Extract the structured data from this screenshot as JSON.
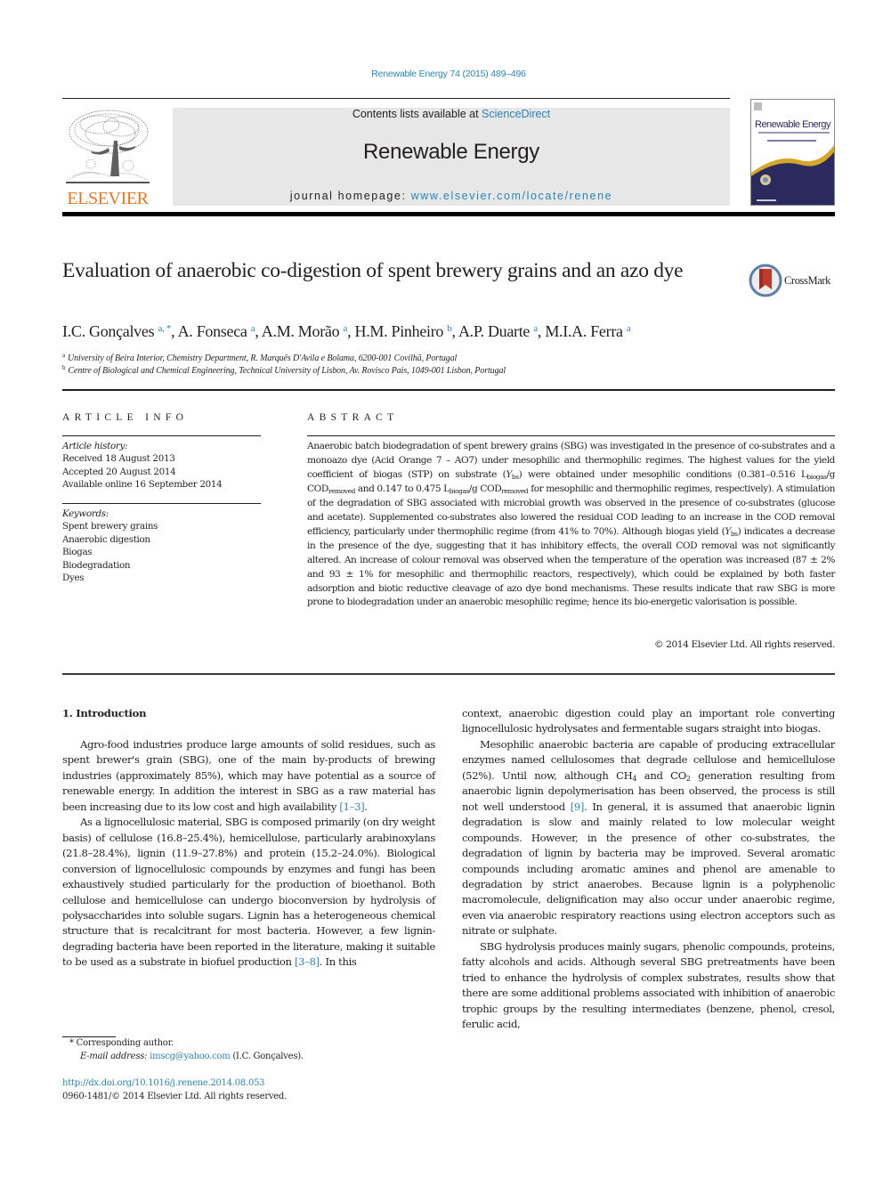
{
  "header": {
    "citation": "Renewable Energy 74 (2015) 489–496",
    "contents_prefix": "Contents lists available at ",
    "contents_link": "ScienceDirect",
    "journal_name": "Renewable Energy",
    "homepage_prefix": "journal homepage: ",
    "homepage_link": "www.elsevier.com/locate/renene",
    "publisher_logo_text": "ELSEVIER",
    "cover_title": "Renewable Energy"
  },
  "crossmark": {
    "label": "CrossMark"
  },
  "article": {
    "title": "Evaluation of anaerobic co-digestion of spent brewery grains and an azo dye",
    "authors": [
      {
        "name": "I.C. Gonçalves",
        "sup": "a, *"
      },
      {
        "name": "A. Fonseca",
        "sup": "a"
      },
      {
        "name": "A.M. Morão",
        "sup": "a"
      },
      {
        "name": "H.M. Pinheiro",
        "sup": "b"
      },
      {
        "name": "A.P. Duarte",
        "sup": "a"
      },
      {
        "name": "M.I.A. Ferra",
        "sup": "a"
      }
    ],
    "affiliations": [
      {
        "key": "a",
        "text": "University of Beira Interior, Chemistry Department, R. Marquês D'Avila e Bolama, 6200-001 Covilhã, Portugal"
      },
      {
        "key": "b",
        "text": "Centre of Biological and Chemical Engineering, Technical University of Lisbon, Av. Rovisco Pais, 1049-001 Lisbon, Portugal"
      }
    ]
  },
  "article_info": {
    "heading": "ARTICLE INFO",
    "history_label": "Article history:",
    "history": [
      "Received 18 August 2013",
      "Accepted 20 August 2014",
      "Available online 16 September 2014"
    ],
    "keywords_label": "Keywords:",
    "keywords": [
      "Spent brewery grains",
      "Anaerobic digestion",
      "Biogas",
      "Biodegradation",
      "Dyes"
    ]
  },
  "abstract": {
    "heading": "ABSTRACT",
    "p1": "Anaerobic batch biodegradation of spent brewery grains (SBG) was investigated in the presence of co-substrates and a monoazo dye (Acid Orange 7 – AO7) under mesophilic and thermophilic regimes. The highest values for the yield coefficient of biogas (STP) on substrate (",
    "ybs_Y": "Y",
    "ybs_sub": "bs",
    "p2": ") were obtained under mesophilic conditions (0.381–0.516 L",
    "sub_biogas": "biogas",
    "p3": "/g COD",
    "sub_removed": "removed",
    "p4": " and 0.147 to 0.475 L",
    "p5": "/g COD",
    "p6": " for mesophilic and thermophilic regimes, respectively). A stimulation of the degradation of SBG associated with microbial growth was observed in the presence of co-substrates (glucose and acetate). Supplemented co-substrates also lowered the residual COD leading to an increase in the COD removal efficiency, particularly under thermophilic regime (from 41% to 70%). Although biogas yield (",
    "p7": ") indicates a decrease in the presence of the dye, suggesting that it has inhibitory effects, the overall COD removal was not significantly altered. An increase of colour removal was observed when the temperature of the operation was increased (87 ± 2% and 93 ± 1% for mesophilic and thermophilic reactors, respectively), which could be explained by both faster adsorption and biotic reductive cleavage of azo dye bond mechanisms. These results indicate that raw SBG is more prone to biodegradation under an anaerobic mesophilic regime; hence its bio-energetic valorisation is possible.",
    "copyright": "© 2014 Elsevier Ltd. All rights reserved."
  },
  "body": {
    "intro_heading": "1.  Introduction",
    "left": {
      "p1_text": "Agro-food industries produce large amounts of solid residues, such as spent brewer's grain (SBG), one of the main by-products of brewing industries (approximately 85%), which may have potential as a source of renewable energy. In addition the interest in SBG as a raw material has been increasing due to its low cost and high availability ",
      "p1_ref": "[1–3]",
      "p1_end": ".",
      "p2_text": "As a lignocellulosic material, SBG is composed primarily (on dry weight basis) of cellulose (16.8–25.4%), hemicellulose, particularly arabinoxylans (21.8–28.4%), lignin (11.9–27.8%) and protein (15.2–24.0%). Biological conversion of lignocellulosic compounds by enzymes and fungi has been exhaustively studied particularly for the production of bioethanol. Both cellulose and hemicellulose can undergo bioconversion by hydrolysis of polysaccharides into soluble sugars. Lignin has a heterogeneous chemical structure that is recalcitrant for most bacteria. However, a few lignin-degrading bacteria have been reported in the literature, making it suitable to be used as a substrate in biofuel production ",
      "p2_ref": "[3–8]",
      "p2_end": ". In this"
    },
    "right": {
      "p1": "context, anaerobic digestion could play an important role converting lignocellulosic hydrolysates and fermentable sugars straight into biogas.",
      "p2_a": "Mesophilic anaerobic bacteria are capable of producing extracellular enzymes named cellulosomes that degrade cellulose and hemicellulose (52%). Until now, although CH",
      "p2_sub1": "4",
      "p2_b": " and CO",
      "p2_sub2": "2",
      "p2_c": " generation resulting from anaerobic lignin depolymerisation has been observed, the process is still not well understood ",
      "p2_ref": "[9]",
      "p2_d": ". In general, it is assumed that anaerobic lignin degradation is slow and mainly related to low molecular weight compounds. However, in the presence of other co-substrates, the degradation of lignin by bacteria may be improved. Several aromatic compounds including aromatic amines and phenol are amenable to degradation by strict anaerobes. Because lignin is a polyphenolic macromolecule, delignification may also occur under anaerobic regime, even via anaerobic respiratory reactions using electron acceptors such as nitrate or sulphate.",
      "p3": "SBG hydrolysis produces mainly sugars, phenolic compounds, proteins, fatty alcohols and acids. Although several SBG pretreatments have been tried to enhance the hydrolysis of complex substrates, results show that there are some additional problems associated with inhibition of anaerobic trophic groups by the resulting intermediates (benzene, phenol, cresol, ferulic acid,"
    }
  },
  "footnotes": {
    "corresponding": "*  Corresponding author.",
    "email_label": "E-mail address: ",
    "email": "imscg@yahoo.com",
    "email_owner": " (I.C. Gonçalves).",
    "doi": "http://dx.doi.org/10.1016/j.renene.2014.08.053",
    "issn_copyright": "0960-1481/© 2014 Elsevier Ltd. All rights reserved."
  },
  "colors": {
    "link": "#2a86b6",
    "elsevier_orange": "#e87722",
    "banner_gray": "#e7e7e8",
    "cover_navy": "#2b2a5e",
    "cover_gold": "#d4a62a",
    "crossmark_red": "#c0392b"
  }
}
